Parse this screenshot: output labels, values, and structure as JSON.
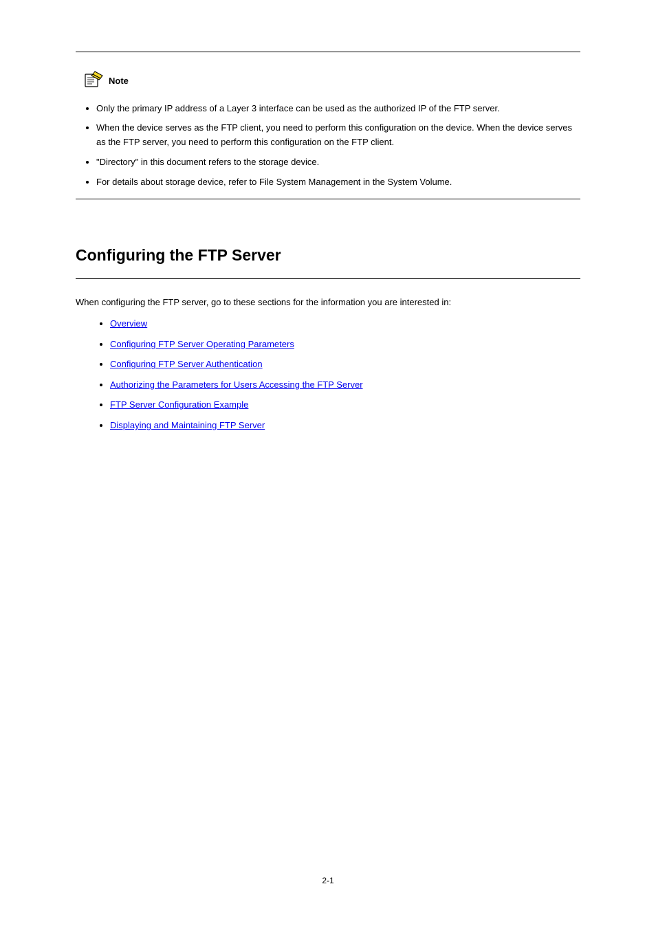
{
  "note": {
    "label": "Note",
    "items": [
      "Only the primary IP address of a Layer 3 interface can be used as the authorized IP of the FTP server.",
      "When the device serves as the FTP client, you need to perform this configuration on the device. When the device serves as the FTP server, you need to perform this configuration on the FTP client.",
      "\"Directory\" in this document refers to the storage device.",
      "For details about storage device, refer to File System Management in the System Volume."
    ]
  },
  "chapter": {
    "title": "Configuring the FTP Server",
    "intro": "When configuring the FTP server, go to these sections for the information you are interested in:",
    "links": [
      "Overview",
      "Configuring FTP Server Operating Parameters",
      "Configuring FTP Server Authentication",
      "Authorizing the Parameters for Users Accessing the FTP Server",
      "FTP Server Configuration Example",
      "Displaying and Maintaining FTP Server"
    ]
  },
  "pageNumber": "2-1"
}
